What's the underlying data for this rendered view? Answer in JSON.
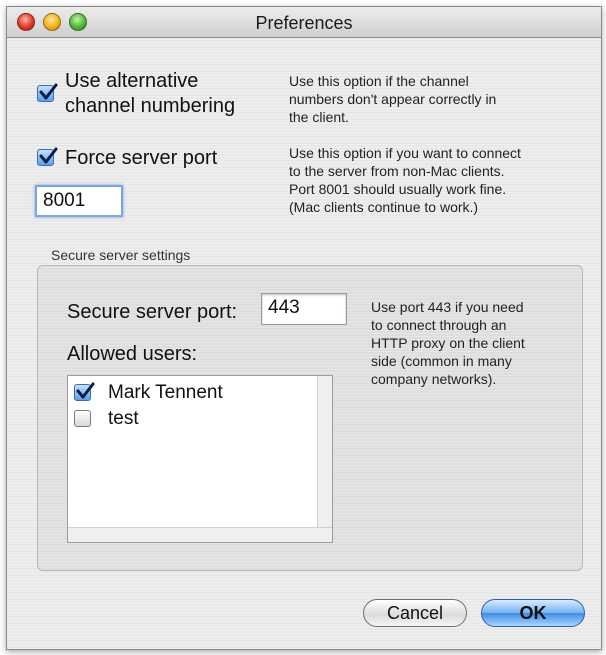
{
  "window": {
    "title": "Preferences"
  },
  "options": {
    "alt_numbering": {
      "checked": true,
      "label_line1": "Use alternative",
      "label_line2": "channel numbering",
      "help_line1": "Use this option if the channel",
      "help_line2": "numbers don't appear correctly in",
      "help_line3": "the client."
    },
    "force_port": {
      "checked": true,
      "label": "Force server port",
      "value": "8001",
      "help_line1": "Use this option if you want to connect",
      "help_line2": "to the server from non-Mac clients.",
      "help_line3": "Port 8001 should usually work fine.",
      "help_line4": "(Mac clients continue to work.)"
    }
  },
  "secure": {
    "group_title": "Secure server settings",
    "port_label": "Secure server port:",
    "port_value": "443",
    "help_line1": "Use port 443 if you need",
    "help_line2": "to connect through an",
    "help_line3": "HTTP proxy on the client",
    "help_line4": "side (common in many",
    "help_line5": "company networks).",
    "allowed_users_label": "Allowed users:",
    "users": [
      {
        "name": "Mark Tennent",
        "checked": true
      },
      {
        "name": "test",
        "checked": false
      }
    ]
  },
  "buttons": {
    "cancel": "Cancel",
    "ok": "OK"
  },
  "colors": {
    "accent": "#3f8be6",
    "focus_ring": "#7aa7e0"
  }
}
